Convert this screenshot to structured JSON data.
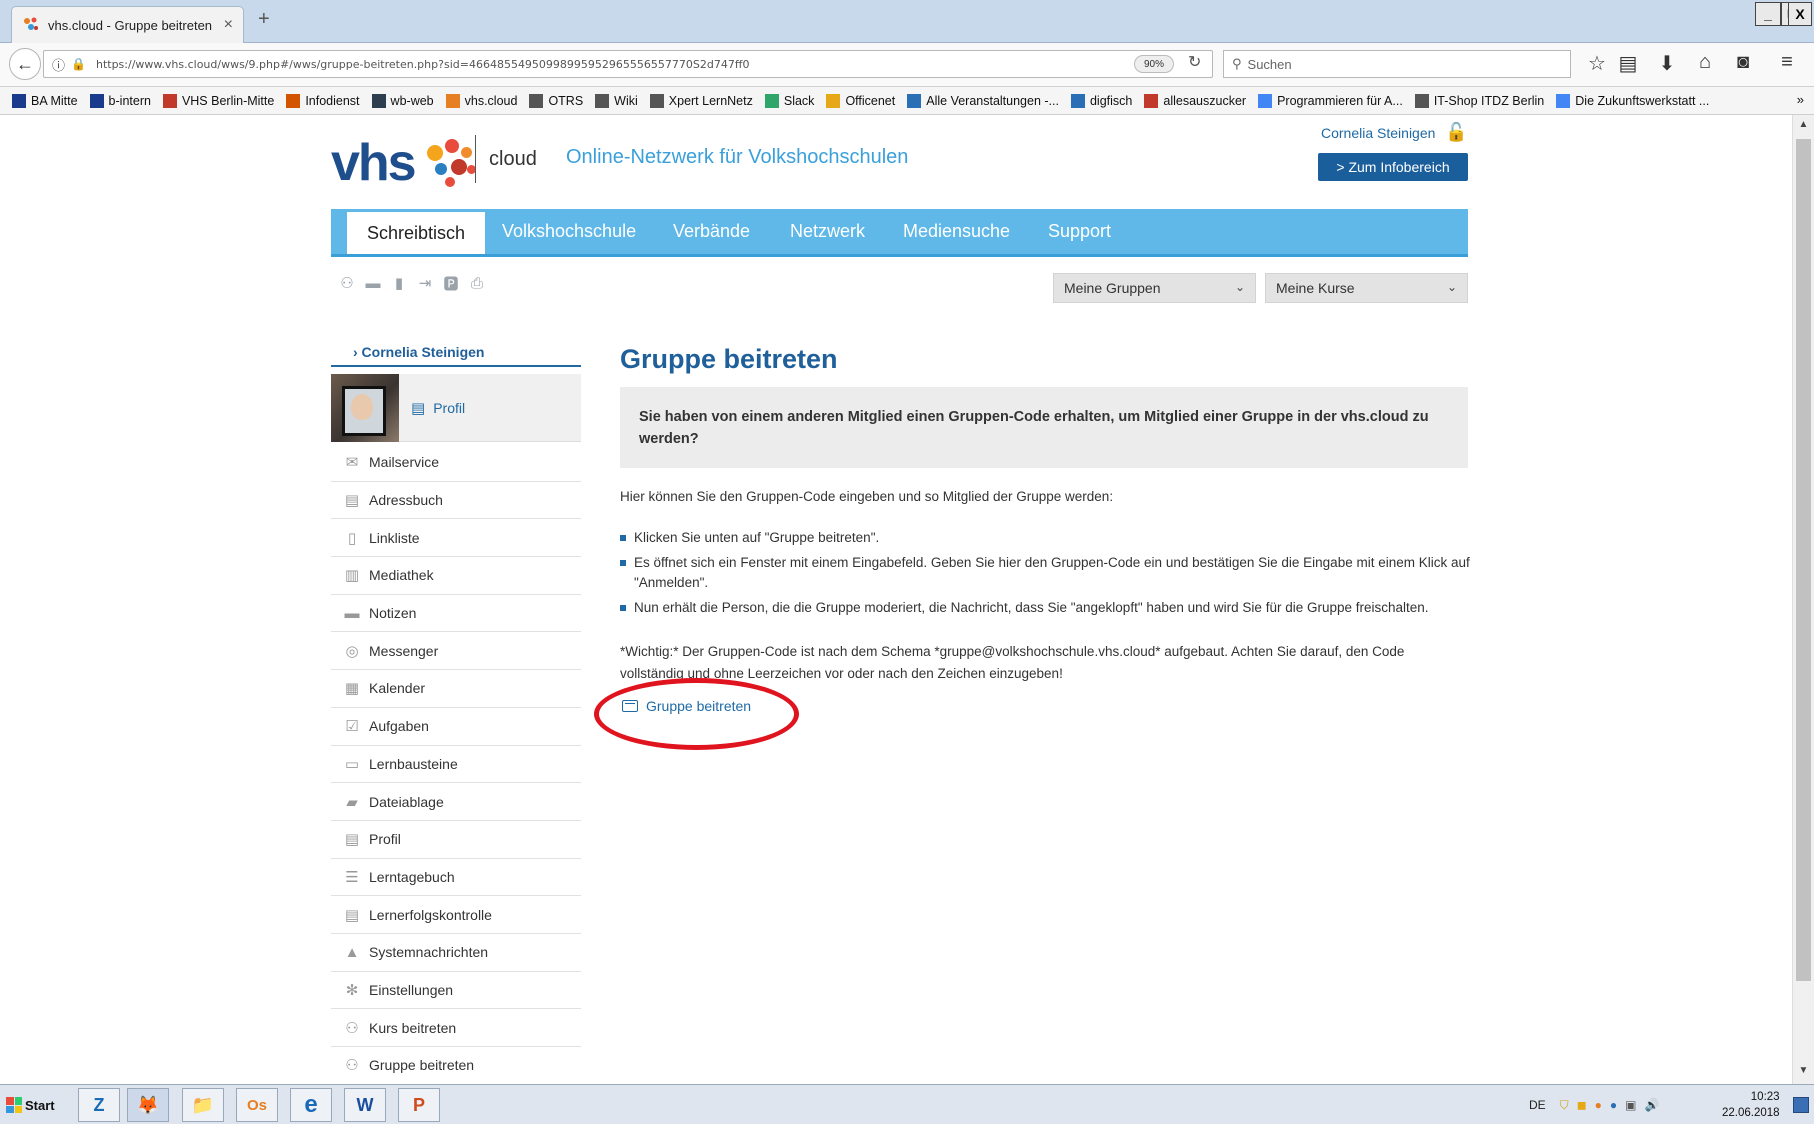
{
  "browser": {
    "tab_title": "vhs.cloud - Gruppe beitreten",
    "tab_close": "×",
    "new_tab": "+",
    "url": "https://www.vhs.cloud/wws/9.php#/wws/gruppe-beitreten.php?sid=46648554950998995952965556557770S2d747ff0",
    "zoom": "90%",
    "search_placeholder": "Suchen",
    "window_controls": [
      "_",
      "🗗",
      "X"
    ],
    "bookmarks": [
      {
        "label": "BA Mitte",
        "color": "#1a3a8c"
      },
      {
        "label": "b-intern",
        "color": "#1a3a8c"
      },
      {
        "label": "VHS Berlin-Mitte",
        "color": "#c0392b"
      },
      {
        "label": "Infodienst",
        "color": "#d35400"
      },
      {
        "label": "wb-web",
        "color": "#2c3e50"
      },
      {
        "label": "vhs.cloud",
        "color": "#e67e22"
      },
      {
        "label": "OTRS",
        "color": "#555555"
      },
      {
        "label": "Wiki",
        "color": "#555555"
      },
      {
        "label": "Xpert LernNetz",
        "color": "#555555"
      },
      {
        "label": "Slack",
        "color": "#2ea66a"
      },
      {
        "label": "Officenet",
        "color": "#e6a817"
      },
      {
        "label": "Alle Veranstaltungen -...",
        "color": "#2a6fb5"
      },
      {
        "label": "digfisch",
        "color": "#2a6fb5"
      },
      {
        "label": "allesauszucker",
        "color": "#c0392b"
      },
      {
        "label": "Programmieren für A...",
        "color": "#4285f4"
      },
      {
        "label": "IT-Shop ITDZ Berlin",
        "color": "#555555"
      },
      {
        "label": "Die Zukunftswerkstatt ...",
        "color": "#4285f4"
      }
    ],
    "bookmarks_more": "»"
  },
  "header": {
    "logo_text": "vhs",
    "logo_sub": "cloud",
    "tagline": "Online-Netzwerk für Volkshochschulen",
    "user_name": "Cornelia Steinigen",
    "info_button": "> Zum Infobereich"
  },
  "nav": {
    "items": [
      "Schreibtisch",
      "Volkshochschule",
      "Verbände",
      "Netzwerk",
      "Mediensuche",
      "Support"
    ],
    "select_groups": "Meine Gruppen",
    "select_courses": "Meine Kurse"
  },
  "sidebar": {
    "user_link": "› Cornelia Steinigen",
    "profile_link": "Profil",
    "items": [
      {
        "label": "Mailservice",
        "icon": "✉"
      },
      {
        "label": "Adressbuch",
        "icon": "▤"
      },
      {
        "label": "Linkliste",
        "icon": "▯"
      },
      {
        "label": "Mediathek",
        "icon": "▥"
      },
      {
        "label": "Notizen",
        "icon": "▬"
      },
      {
        "label": "Messenger",
        "icon": "◎"
      },
      {
        "label": "Kalender",
        "icon": "▦"
      },
      {
        "label": "Aufgaben",
        "icon": "☑"
      },
      {
        "label": "Lernbausteine",
        "icon": "▭"
      },
      {
        "label": "Dateiablage",
        "icon": "▰"
      },
      {
        "label": "Profil",
        "icon": "▤"
      },
      {
        "label": "Lerntagebuch",
        "icon": "☰"
      },
      {
        "label": "Lernerfolgskontrolle",
        "icon": "▤"
      },
      {
        "label": "Systemnachrichten",
        "icon": "▲"
      },
      {
        "label": "Einstellungen",
        "icon": "✻"
      },
      {
        "label": "Kurs beitreten",
        "icon": "⚇"
      },
      {
        "label": "Gruppe beitreten",
        "icon": "⚇"
      }
    ]
  },
  "content": {
    "title": "Gruppe beitreten",
    "notice": "Sie haben von einem anderen Mitglied einen Gruppen-Code erhalten, um Mitglied einer Gruppe in der vhs.cloud zu werden?",
    "intro": "Hier können Sie den Gruppen-Code eingeben und so Mitglied der Gruppe werden:",
    "bullets": [
      "Klicken Sie unten auf \"Gruppe beitreten\".",
      "Es öffnet sich ein Fenster mit einem Eingabefeld. Geben Sie hier den Gruppen-Code ein und bestätigen Sie die Eingabe mit einem Klick auf \"Anmelden\".",
      "Nun erhält die Person, die die Gruppe moderiert, die Nachricht, dass Sie \"angeklopft\" haben und wird Sie für die Gruppe freischalten."
    ],
    "important": "*Wichtig:* Der Gruppen-Code ist nach dem Schema *gruppe@volkshochschule.vhs.cloud* aufgebaut. Achten Sie darauf, den Code vollständig und ohne Leerzeichen vor oder nach den Zeichen einzugeben!",
    "join_link": "Gruppe beitreten"
  },
  "taskbar": {
    "start": "Start",
    "apps": [
      "Z",
      "🦊",
      "📁",
      "Os",
      "e",
      "W",
      "P"
    ],
    "lang": "DE",
    "time": "10:23",
    "date": "22.06.2018"
  },
  "colors": {
    "brand_blue": "#1f5f9a",
    "nav_blue": "#5fb8e8",
    "annotation_red": "#e0141e"
  }
}
